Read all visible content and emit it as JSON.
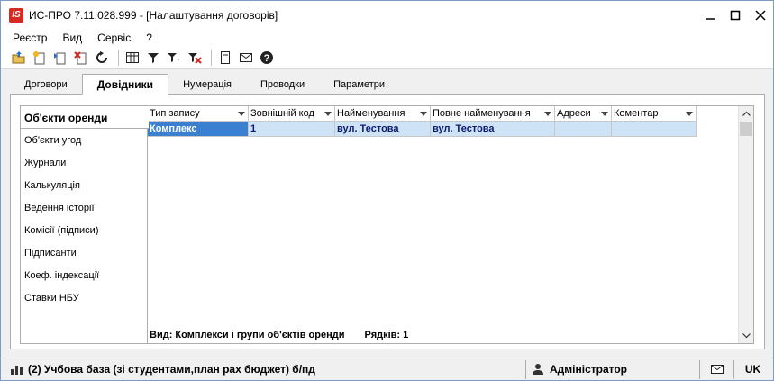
{
  "window": {
    "logo_text": "IS",
    "title": "ИС-ПРО 7.11.028.999 - [Налаштування договорів]"
  },
  "menu": [
    "Реєстр",
    "Вид",
    "Сервіс",
    "?"
  ],
  "toolbar": {
    "buttons": [
      "open-folder",
      "new-doc",
      "copy-doc",
      "delete-doc",
      "refresh",
      "table-view",
      "filter",
      "filter-clear",
      "filter-off",
      "page",
      "mail",
      "help"
    ]
  },
  "tabs": [
    "Договори",
    "Довідники",
    "Нумерація",
    "Проводки",
    "Параметри"
  ],
  "active_tab": "Довідники",
  "nav": {
    "items": [
      "Об'єкти оренди",
      "Об'єкти угод",
      "Журнали",
      "Калькуляція",
      "Ведення історії",
      "Комісії (підписи)",
      "Підписанти",
      "Коеф. індексації",
      "Ставки НБУ"
    ],
    "active": "Об'єкти оренди"
  },
  "grid": {
    "columns": [
      "Тип запису",
      "Зовнішній код",
      "Найменування",
      "Повне найменування",
      "Адреси",
      "Коментар"
    ],
    "rows": [
      [
        "Комплекс",
        "1",
        "вул. Тестова",
        "вул. Тестова",
        "",
        ""
      ]
    ],
    "footer_view": "Вид: Комплекси і групи об'єктів оренди",
    "footer_count": "Рядків: 1"
  },
  "status": {
    "database": "(2) Учбова база (зі студентами,план рах бюджет) б/пд",
    "user": "Адміністратор",
    "language": "UK"
  },
  "colors": {
    "selected_row": "#cfe3f7",
    "selected_cell": "#3b7fd0",
    "logo": "#d42a1f"
  }
}
